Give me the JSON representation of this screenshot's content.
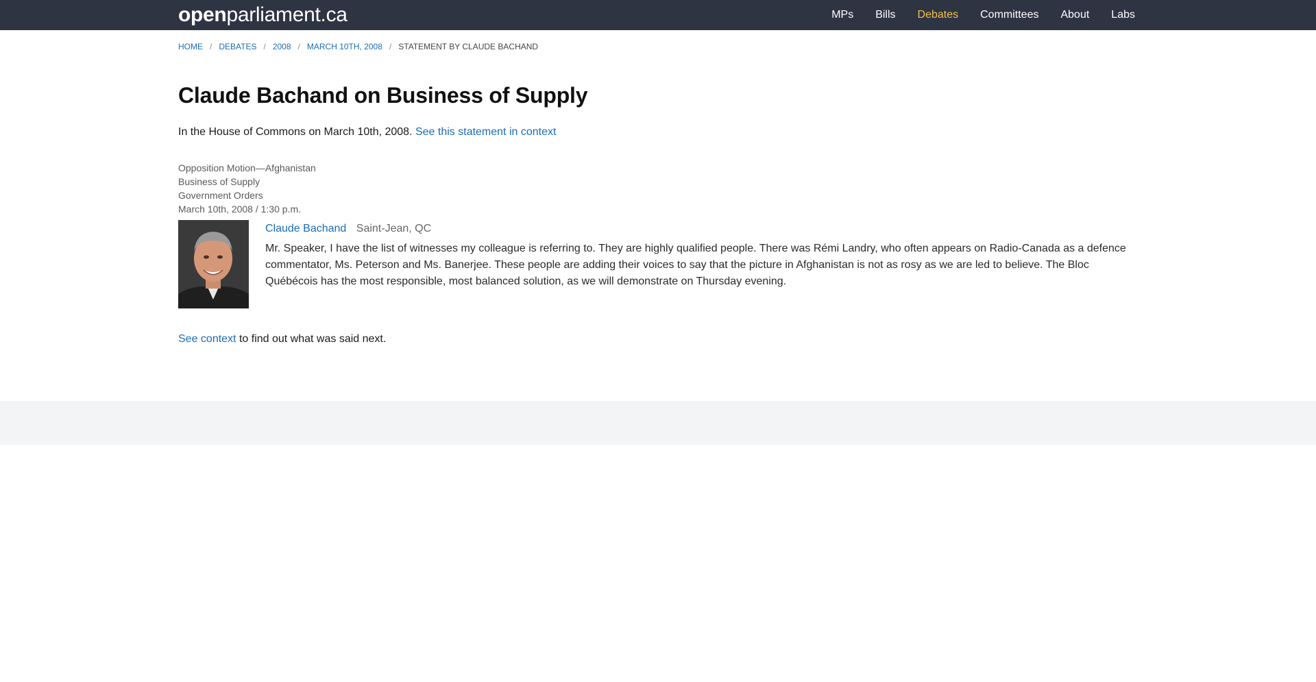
{
  "header": {
    "logo_bold": "open",
    "logo_rest": "parliament",
    "logo_tld": ".ca",
    "nav": [
      {
        "label": "MPs",
        "active": false
      },
      {
        "label": "Bills",
        "active": false
      },
      {
        "label": "Debates",
        "active": true
      },
      {
        "label": "Committees",
        "active": false
      },
      {
        "label": "About",
        "active": false
      },
      {
        "label": "Labs",
        "active": false
      }
    ],
    "active_color": "#f5c050",
    "bar_color": "#2f3443"
  },
  "breadcrumb": {
    "items": [
      "HOME",
      "DEBATES",
      "2008",
      "MARCH 10TH, 2008"
    ],
    "separator": "/",
    "current": "STATEMENT BY CLAUDE BACHAND"
  },
  "page": {
    "title": "Claude Bachand on Business of Supply",
    "context_prefix": "In the House of Commons on March 10th, 2008.",
    "context_link": "See this statement in context"
  },
  "meta": {
    "lines": [
      "Opposition Motion—Afghanistan",
      "Business of Supply",
      "Government Orders",
      "March 10th, 2008 / 1:30 p.m."
    ]
  },
  "statement": {
    "speaker_name": "Claude Bachand",
    "speaker_riding": "Saint-Jean, QC",
    "text": "Mr. Speaker, I have the list of witnesses my colleague is referring to. They are highly qualified people. There was Rémi Landry, who often appears on Radio-Canada as a defence commentator, Ms. Peterson and Ms. Banerjee. These people are adding their voices to say that the picture in Afghanistan is not as rosy as we are led to believe. The Bloc Québécois has the most responsible, most balanced solution, as we will demonstrate on Thursday evening."
  },
  "next": {
    "link": "See context",
    "suffix": "to find out what was said next."
  },
  "colors": {
    "link": "#1a6cb8",
    "footer": "#f3f4f6"
  }
}
